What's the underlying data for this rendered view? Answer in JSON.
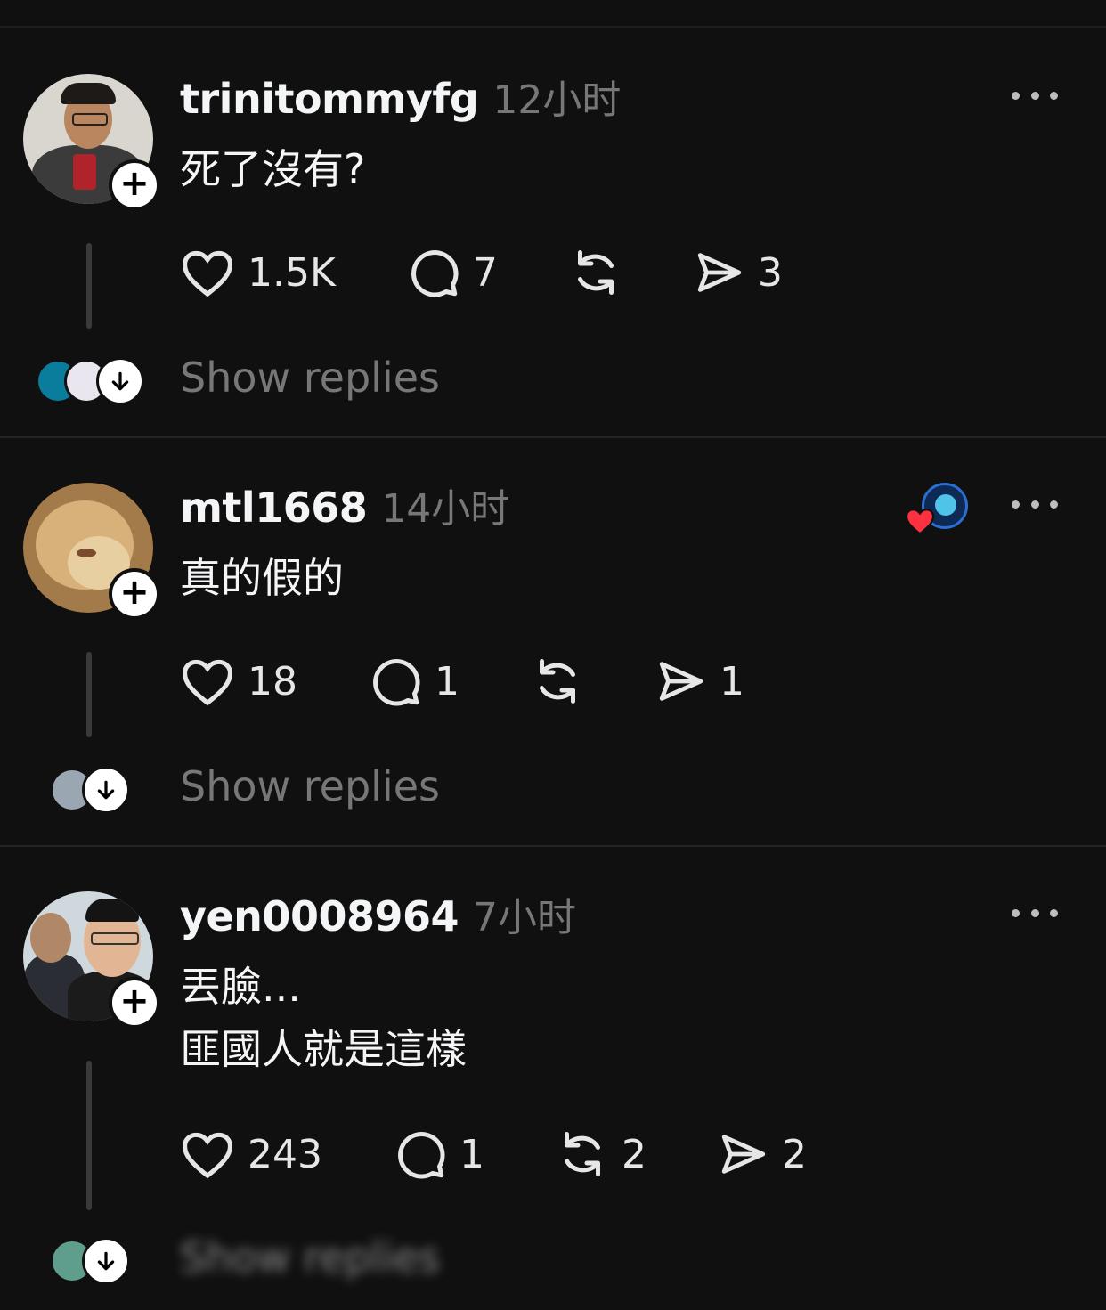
{
  "posts": [
    {
      "username": "trinitommyfg",
      "time": "12小时",
      "text": "死了沒有?",
      "likes": "1.5K",
      "replies": "7",
      "reposts": "",
      "shares": "3",
      "show_replies": "Show replies"
    },
    {
      "username": "mtl1668",
      "time": "14小时",
      "text": "真的假的",
      "likes": "18",
      "replies": "1",
      "reposts": "",
      "shares": "1",
      "show_replies": "Show replies"
    },
    {
      "username": "yen0008964",
      "time": "7小时",
      "text": "丟臉...\n匪國人就是這樣",
      "likes": "243",
      "replies": "1",
      "reposts": "2",
      "shares": "2",
      "show_replies": "Show replies"
    }
  ],
  "icons": {
    "like": "heart-icon",
    "reply": "comment-bubble-icon",
    "repost": "repost-icon",
    "share": "send-icon",
    "more": "more-dots-icon",
    "follow": "plus-icon",
    "expand": "arrow-down-icon"
  },
  "colors": {
    "background": "#101010",
    "text": "#f3f5f7",
    "muted": "#777777",
    "heart_red": "#ff3040"
  }
}
